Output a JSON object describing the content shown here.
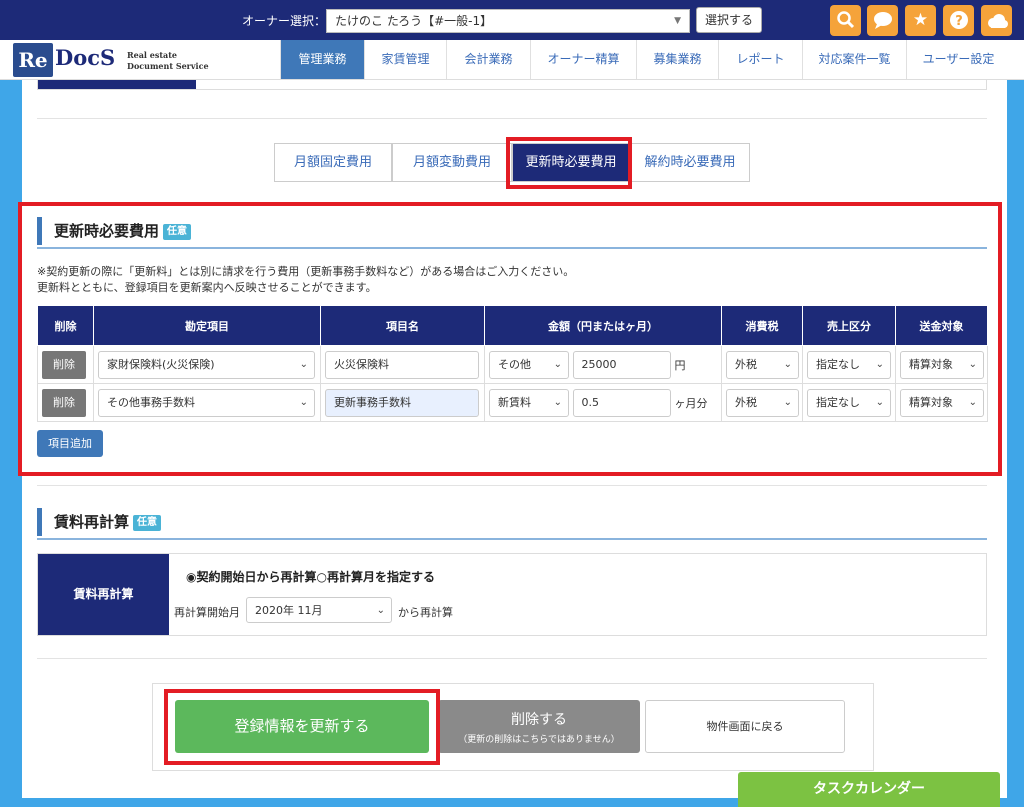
{
  "header": {
    "owner_label": "オーナー選択：",
    "owner_value": "たけのこ たろう【#一般-1】",
    "select_button": "選択する",
    "icons": [
      "search-icon",
      "chat-icon",
      "star-icon",
      "help-icon",
      "cloud-icon"
    ]
  },
  "logo": {
    "re": "Re",
    "docs": "DocS",
    "line1": "Real estate",
    "line2": "Document Service"
  },
  "nav": {
    "tabs": [
      "管理業務",
      "家賃管理",
      "会計業務",
      "オーナー精算",
      "募集業務",
      "レポート",
      "対応案件一覧",
      "ユーザー設定"
    ],
    "active": "管理業務"
  },
  "subtabs": {
    "items": [
      "月額固定費用",
      "月額変動費用",
      "更新時必要費用",
      "解約時必要費用"
    ],
    "active": "更新時必要費用"
  },
  "renewal": {
    "title": "更新時必要費用",
    "badge": "任意",
    "note1": "※契約更新の際に「更新料」とは別に請求を行う費用（更新事務手数料など）がある場合はご入力ください。",
    "note2": "更新料とともに、登録項目を更新案内へ反映させることができます。",
    "columns": [
      "削除",
      "勘定項目",
      "項目名",
      "金額（円またはヶ月）",
      "消費税",
      "売上区分",
      "送金対象"
    ],
    "rows": [
      {
        "delete": "削除",
        "account": "家財保険料(火災保険)",
        "item_name": "火災保険料",
        "amount_type": "その他",
        "amount": "25000",
        "unit": "円",
        "tax": "外税",
        "sales": "指定なし",
        "remit": "精算対象"
      },
      {
        "delete": "削除",
        "account": "その他事務手数料",
        "item_name": "更新事務手数料",
        "amount_type": "新賃料",
        "amount": "0.5",
        "unit": "ヶ月分",
        "tax": "外税",
        "sales": "指定なし",
        "remit": "精算対象"
      }
    ],
    "add_button": "項目追加"
  },
  "recalc": {
    "title": "賃料再計算",
    "badge": "任意",
    "head": "賃料再計算",
    "option1": "◉契約開始日から再計算",
    "option2": "○再計算月を指定する",
    "month_label": "再計算開始月",
    "month_value": "2020年 11月",
    "suffix": "から再計算"
  },
  "actions": {
    "update": "登録情報を更新する",
    "delete": "削除する",
    "delete_note": "（更新の削除はこちらではありません）",
    "back": "物件画面に戻る"
  },
  "task_calendar": "タスクカレンダー",
  "colors": {
    "navy": "#1d2a78",
    "blue": "#3f78b8",
    "green": "#5cb85c",
    "orange": "#f5a33a",
    "red_highlight": "#e31c24"
  }
}
